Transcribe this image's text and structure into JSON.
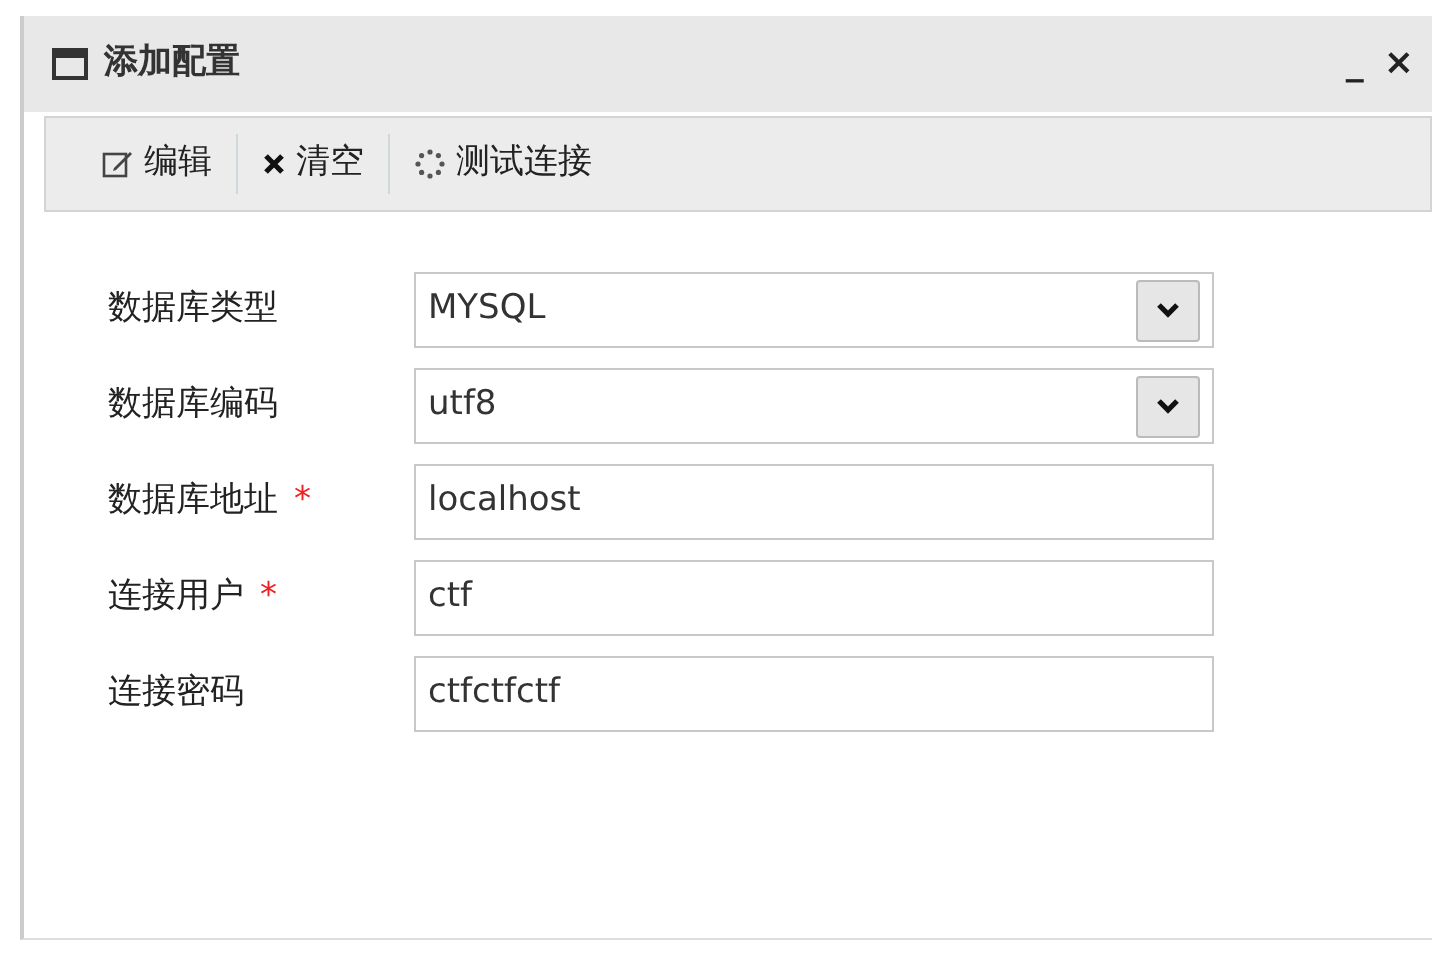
{
  "window": {
    "title": "添加配置",
    "controls": [
      "_",
      "×"
    ]
  },
  "toolbar": [
    {
      "kind": "edit",
      "label": "编辑"
    },
    {
      "kind": "clear",
      "label": "清空"
    },
    {
      "kind": "test",
      "label": "测试连接"
    }
  ],
  "fields": [
    {
      "label": "数据库类型",
      "kind": "select",
      "value": "MYSQL"
    },
    {
      "label": "数据库编码",
      "kind": "select",
      "value": "utf8"
    },
    {
      "label": "数据库地址",
      "kind": "text",
      "value": "localhost",
      "required_mark": "*"
    },
    {
      "label": "连接用户",
      "kind": "text",
      "value": "ctf",
      "required_mark": "*"
    },
    {
      "label": "连接密码",
      "kind": "text",
      "value": "ctfctfctf"
    }
  ]
}
